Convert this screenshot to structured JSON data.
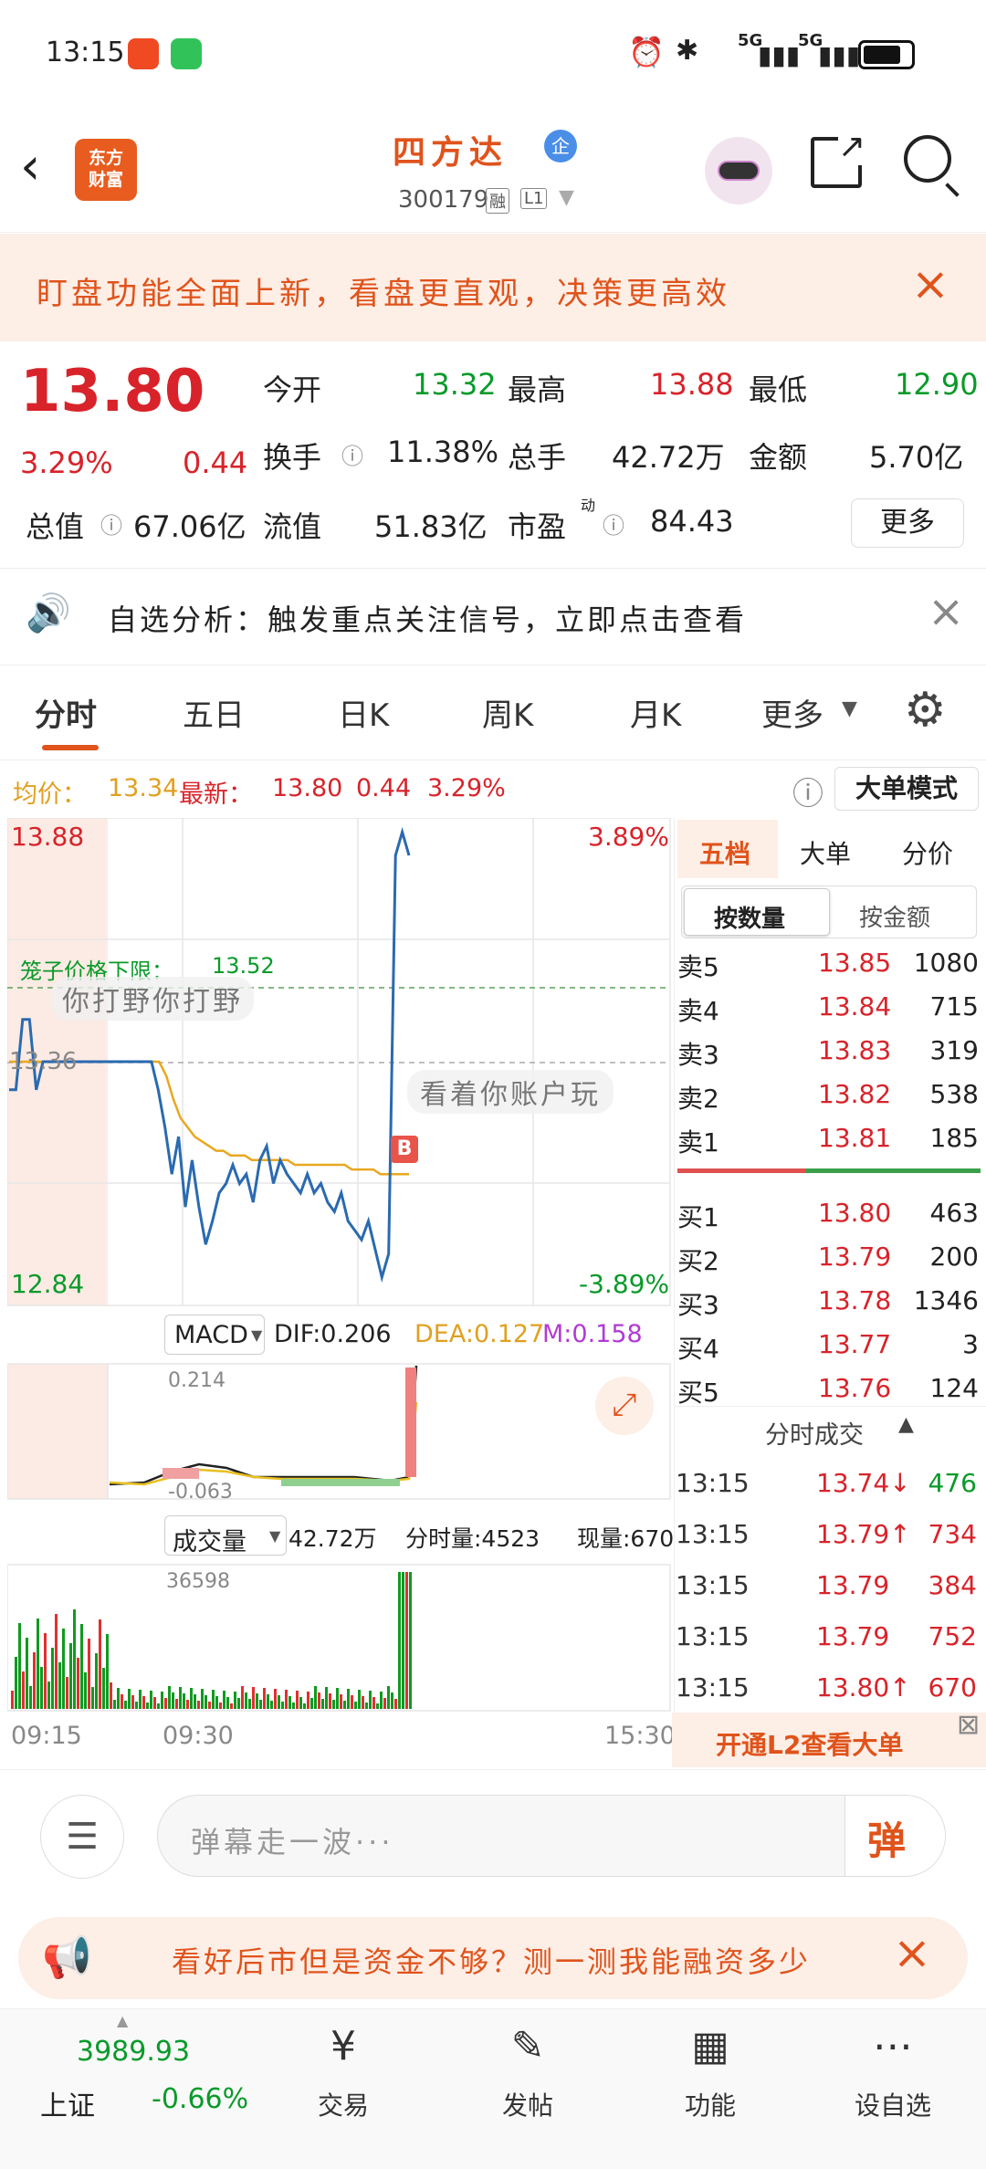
{
  "status": {
    "time": "13:15",
    "net1": "5G",
    "net2": "5G"
  },
  "header": {
    "logo": "东方\n财富",
    "stock_name": "四方达",
    "corp_badge": "企",
    "stock_code": "300179",
    "tag_margin": "融",
    "tag_level": "L1"
  },
  "banner_top": {
    "text": "盯盘功能全面上新，看盘更直观，决策更高效"
  },
  "quote": {
    "price": "13.80",
    "change_pct": "3.29%",
    "change_amt": "0.44",
    "open_label": "今开",
    "open": "13.32",
    "high_label": "最高",
    "high": "13.88",
    "low_label": "最低",
    "low": "12.90",
    "turnover_label": "换手",
    "turnover": "11.38%",
    "volume_label": "总手",
    "volume": "42.72万",
    "amount_label": "金额",
    "amount": "5.70亿",
    "mcap_label": "总值",
    "mcap": "67.06亿",
    "float_label": "流值",
    "float": "51.83亿",
    "pe_label": "市盈",
    "pe_sup": "动",
    "pe": "84.43",
    "more_button": "更多"
  },
  "alert": {
    "text": "自选分析：触发重点关注信号，立即点击查看"
  },
  "tabs": [
    "分时",
    "五日",
    "日K",
    "周K",
    "月K",
    "更多"
  ],
  "chart_info": {
    "avg_label": "均价：",
    "avg": "13.34",
    "latest_label": "最新：",
    "latest": "13.80",
    "chg": "0.44",
    "chg_pct": "3.29%",
    "mode_button": "大单模式"
  },
  "chart_data": {
    "type": "line",
    "price_max": "13.88",
    "price_min": "12.84",
    "pct_max": "3.89%",
    "pct_min": "-3.89%",
    "prev_close": "13.36",
    "limit_label": "笼子价格下限：",
    "limit_value": "13.52",
    "buy_marker": "B",
    "danmaku1": "你打野你打野",
    "danmaku2": "看着你账户玩",
    "x_ticks": [
      "09:15",
      "09:30",
      "15:30"
    ],
    "ylim": [
      12.84,
      13.88
    ],
    "price_series": [
      13.3,
      13.3,
      13.45,
      13.45,
      13.3,
      13.36,
      13.36,
      13.36,
      13.36,
      13.36,
      13.36,
      13.36,
      13.36,
      13.36,
      13.36,
      13.36,
      13.36,
      13.36,
      13.36,
      13.36,
      13.36,
      13.36,
      13.3,
      13.22,
      13.12,
      13.2,
      13.05,
      13.15,
      13.05,
      12.97,
      13.02,
      13.08,
      13.1,
      13.14,
      13.1,
      13.12,
      13.06,
      13.15,
      13.18,
      13.1,
      13.15,
      13.12,
      13.1,
      13.08,
      13.12,
      13.08,
      13.1,
      13.06,
      13.04,
      13.08,
      13.02,
      13.0,
      12.98,
      13.02,
      12.96,
      12.9,
      12.95,
      13.8,
      13.85,
      13.8
    ],
    "avg_series": [
      13.36,
      13.36,
      13.36,
      13.36,
      13.36,
      13.36,
      13.36,
      13.36,
      13.36,
      13.36,
      13.36,
      13.36,
      13.36,
      13.36,
      13.36,
      13.36,
      13.36,
      13.36,
      13.36,
      13.36,
      13.36,
      13.36,
      13.33,
      13.28,
      13.24,
      13.22,
      13.2,
      13.19,
      13.18,
      13.17,
      13.17,
      13.16,
      13.16,
      13.16,
      13.15,
      13.15,
      13.15,
      13.15,
      13.15,
      13.15,
      13.14,
      13.14,
      13.14,
      13.14,
      13.14,
      13.14,
      13.14,
      13.14,
      13.13,
      13.13,
      13.13,
      13.13,
      13.12,
      13.12,
      13.12,
      13.12,
      13.12,
      13.34,
      13.34,
      13.34
    ],
    "macd_label": "MACD",
    "dif": "DIF:0.206",
    "dea": "DEA:0.127",
    "m": "M:0.158",
    "macd_top": "0.214",
    "macd_bottom": "-0.063",
    "vol_label": "成交量",
    "vol_total": "42.72万",
    "vol_minute": "分时量:4523",
    "vol_current": "现量:670",
    "vol_max": "36598"
  },
  "orderbook": {
    "tabs": [
      "五档",
      "大单",
      "分价"
    ],
    "subtabs": [
      "按数量",
      "按金额"
    ],
    "asks": [
      {
        "label": "卖5",
        "price": "13.85",
        "vol": "1080"
      },
      {
        "label": "卖4",
        "price": "13.84",
        "vol": "715"
      },
      {
        "label": "卖3",
        "price": "13.83",
        "vol": "319"
      },
      {
        "label": "卖2",
        "price": "13.82",
        "vol": "538"
      },
      {
        "label": "卖1",
        "price": "13.81",
        "vol": "185"
      }
    ],
    "bids": [
      {
        "label": "买1",
        "price": "13.80",
        "vol": "463"
      },
      {
        "label": "买2",
        "price": "13.79",
        "vol": "200"
      },
      {
        "label": "买3",
        "price": "13.78",
        "vol": "1346"
      },
      {
        "label": "买4",
        "price": "13.77",
        "vol": "3"
      },
      {
        "label": "买5",
        "price": "13.76",
        "vol": "124"
      }
    ],
    "ticks_title": "分时成交",
    "ticks": [
      {
        "time": "13:15",
        "price": "13.74↓",
        "vol": "476",
        "up": false
      },
      {
        "time": "13:15",
        "price": "13.79↑",
        "vol": "734",
        "up": true
      },
      {
        "time": "13:15",
        "price": "13.79",
        "vol": "384",
        "up": true
      },
      {
        "time": "13:15",
        "price": "13.79",
        "vol": "752",
        "up": true
      },
      {
        "time": "13:15",
        "price": "13.80↑",
        "vol": "670",
        "up": true
      }
    ],
    "l2_promo": "开通L2查看大单"
  },
  "comment": {
    "placeholder": "弹幕走一波···",
    "button": "弹"
  },
  "banner_bottom": {
    "text": "看好后市但是资金不够？测一测我能融资多少"
  },
  "bottomnav": {
    "index_name": "上证",
    "index_value": "3989.93",
    "index_change": "-0.66%",
    "items": [
      "交易",
      "发帖",
      "功能",
      "设自选"
    ]
  }
}
